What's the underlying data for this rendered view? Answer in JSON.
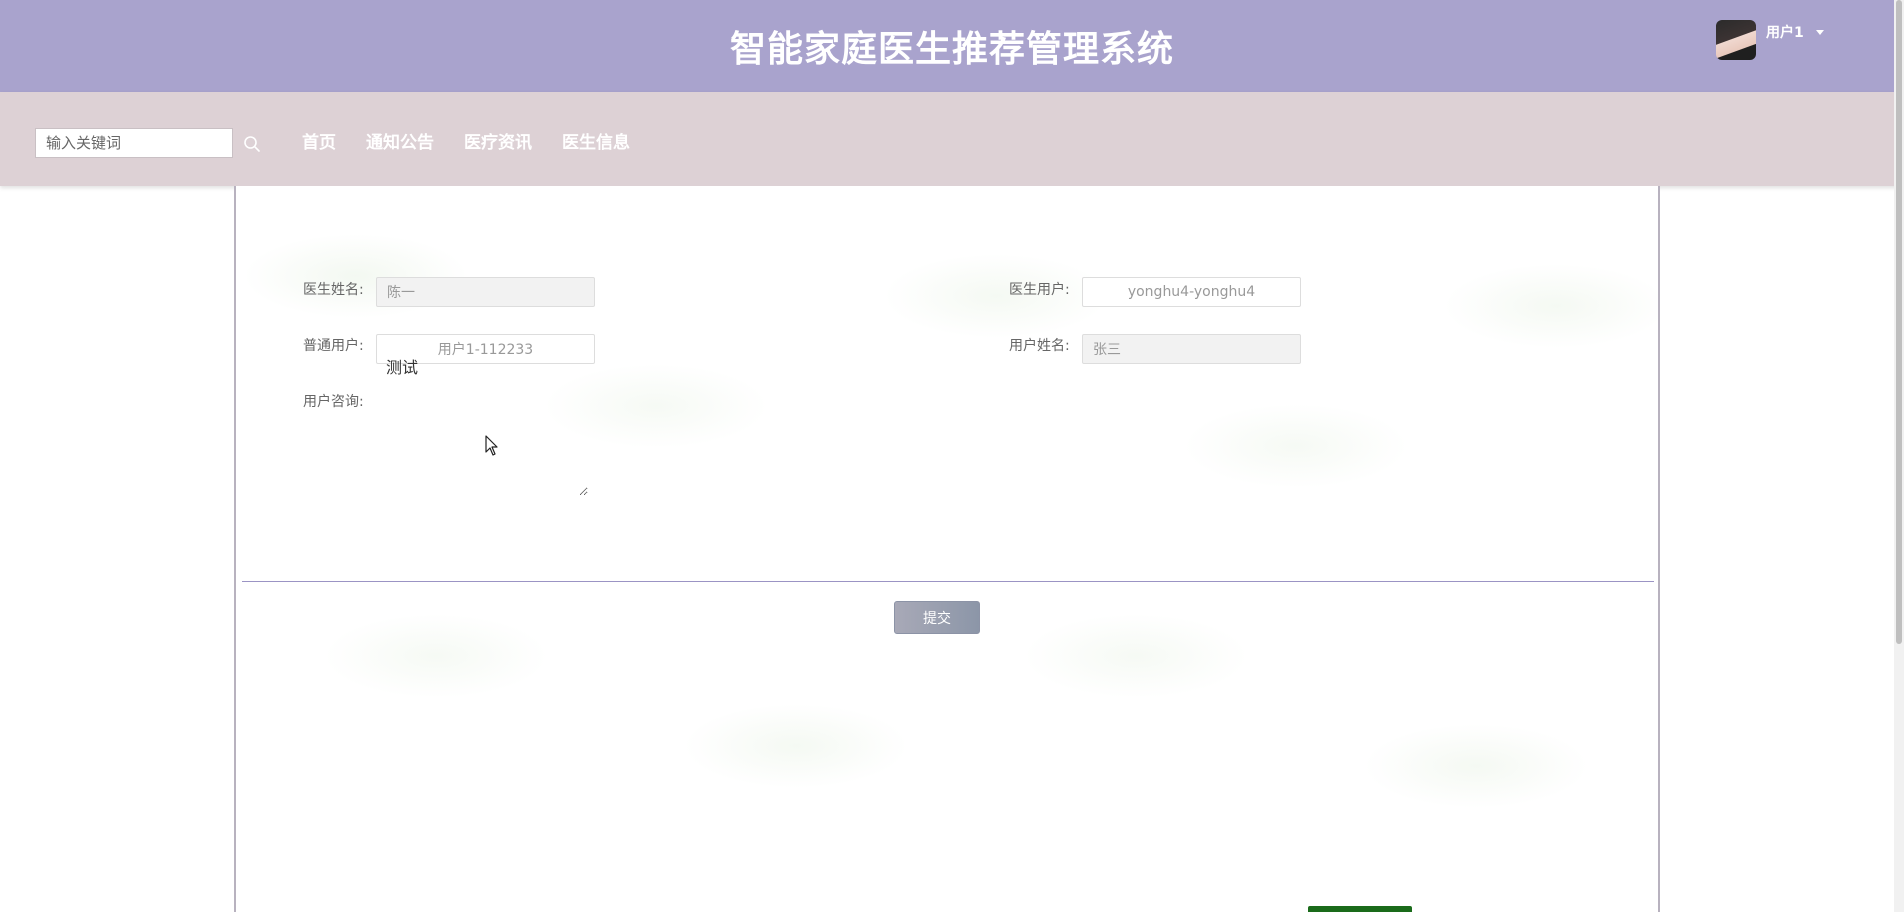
{
  "header": {
    "title": "智能家庭医生推荐管理系统",
    "user_name": "用户1"
  },
  "navbar": {
    "search_placeholder": "输入关键词",
    "links": [
      "首页",
      "通知公告",
      "医疗资讯",
      "医生信息"
    ]
  },
  "form": {
    "doctor_name_label": "医生姓名:",
    "doctor_name_value": "陈一",
    "doctor_user_label": "医生用户:",
    "doctor_user_value": "yonghu4-yonghu4",
    "normal_user_label": "普通用户:",
    "normal_user_value": "用户1-112233",
    "user_name_label": "用户姓名:",
    "user_name_value": "张三",
    "consult_label": "用户咨询:",
    "consult_value": "测试"
  },
  "submit_label": "提交",
  "colors": {
    "header_bg": "#a9a3cd",
    "navbar_bg": "#ddd1d5",
    "divider": "#9b94c4",
    "submit_gradient_start": "#a8a9b7",
    "submit_gradient_end": "#8c96a8"
  }
}
